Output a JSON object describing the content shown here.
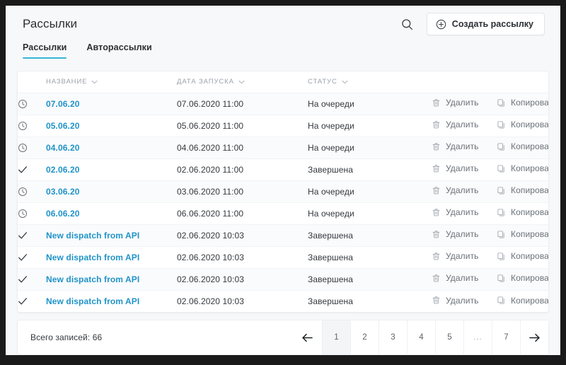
{
  "header": {
    "title": "Рассылки",
    "search_icon": "search-icon",
    "create_label": "Создать рассылку",
    "create_icon": "plus-circle-icon"
  },
  "tabs": [
    {
      "label": "Рассылки",
      "active": true
    },
    {
      "label": "Авторассылки",
      "active": false
    }
  ],
  "table": {
    "columns": [
      {
        "key": "icon",
        "label": ""
      },
      {
        "key": "name",
        "label": "НАЗВАНИЕ",
        "sortable": true
      },
      {
        "key": "date",
        "label": "ДАТА ЗАПУСКА",
        "sortable": true
      },
      {
        "key": "status",
        "label": "СТАТУС",
        "sortable": true
      },
      {
        "key": "delete",
        "label": ""
      },
      {
        "key": "copy",
        "label": ""
      }
    ],
    "actions": {
      "delete_label": "Удалить",
      "delete_icon": "trash-icon",
      "copy_label": "Копировать",
      "copy_icon": "copy-icon"
    },
    "rows": [
      {
        "icon": "clock-icon",
        "name": "07.06.20",
        "date": "07.06.2020 11:00",
        "status": "На очереди"
      },
      {
        "icon": "clock-icon",
        "name": "05.06.20",
        "date": "05.06.2020 11:00",
        "status": "На очереди"
      },
      {
        "icon": "clock-icon",
        "name": "04.06.20",
        "date": "04.06.2020 11:00",
        "status": "На очереди"
      },
      {
        "icon": "check-icon",
        "name": "02.06.20",
        "date": "02.06.2020 11:00",
        "status": "Завершена"
      },
      {
        "icon": "clock-icon",
        "name": "03.06.20",
        "date": "03.06.2020 11:00",
        "status": "На очереди"
      },
      {
        "icon": "clock-icon",
        "name": "06.06.20",
        "date": "06.06.2020 11:00",
        "status": "На очереди"
      },
      {
        "icon": "check-icon",
        "name": "New dispatch from API",
        "date": "02.06.2020 10:03",
        "status": "Завершена"
      },
      {
        "icon": "check-icon",
        "name": "New dispatch from API",
        "date": "02.06.2020 10:03",
        "status": "Завершена"
      },
      {
        "icon": "check-icon",
        "name": "New dispatch from API",
        "date": "02.06.2020 10:03",
        "status": "Завершена"
      },
      {
        "icon": "check-icon",
        "name": "New dispatch from API",
        "date": "02.06.2020 10:03",
        "status": "Завершена"
      }
    ]
  },
  "footer": {
    "total_text": "Всего записей: 66",
    "prev_icon": "arrow-left-icon",
    "next_icon": "arrow-right-icon",
    "pages": [
      {
        "label": "1",
        "active": true
      },
      {
        "label": "2",
        "active": false
      },
      {
        "label": "3",
        "active": false
      },
      {
        "label": "4",
        "active": false
      },
      {
        "label": "5",
        "active": false
      },
      {
        "label": "...",
        "active": false,
        "dots": true
      },
      {
        "label": "7",
        "active": false
      }
    ]
  },
  "colors": {
    "accent": "#3ab5d6",
    "link": "#1f93c8",
    "text": "#33383d",
    "muted": "#9aa1aa",
    "page_bg": "#f7f8fa"
  }
}
